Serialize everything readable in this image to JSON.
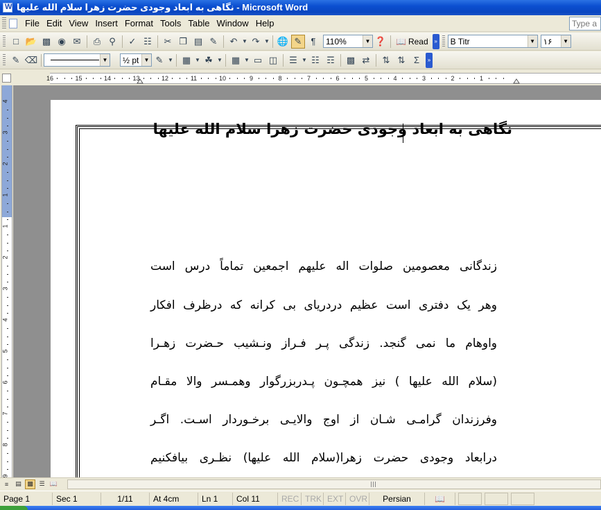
{
  "window": {
    "title": "نگاهی به ابعاد وجودی حضرت زهرا سلام الله علیها - Microsoft Word"
  },
  "menu": {
    "items": [
      {
        "label": "File"
      },
      {
        "label": "Edit"
      },
      {
        "label": "View"
      },
      {
        "label": "Insert"
      },
      {
        "label": "Format"
      },
      {
        "label": "Tools"
      },
      {
        "label": "Table"
      },
      {
        "label": "Window"
      },
      {
        "label": "Help"
      }
    ],
    "help_placeholder": "Type a"
  },
  "toolbar_standard": {
    "zoom": "110%",
    "read_label": "Read",
    "font_name": "B Titr",
    "font_size": "۱۶"
  },
  "toolbar_formatting": {
    "line_weight": "½ pt"
  },
  "ruler": {
    "labels": [
      "16",
      "15",
      "14",
      "13",
      "12",
      "11",
      "10",
      "9",
      "8",
      "7",
      "6",
      "5",
      "4",
      "3",
      "2",
      "1"
    ],
    "vertical_labels": [
      "4",
      "3",
      "2",
      "1",
      "1",
      "2",
      "3",
      "4",
      "5",
      "6",
      "7",
      "8",
      "9"
    ]
  },
  "document": {
    "title": "نگاهی به ابعاد وجودی حضرت زهرا سلام الله علیها",
    "lines": [
      "زندگانی معصومین صلوات اله علیهم اجمعین تماماً درس است",
      "وهر یک دفتری است عظیم دردریای بی کرانه که درظرف افکار",
      "واوهام ما نمی گنجد. زندگی پـر فـراز ونـشیب حـضرت زهـرا",
      "(سلام الله علیها ) نیز همچـون پـدربزرگوار وهمـسر والا مقـام",
      "وفرزندان گرامـی شـان از اوج والایـی برخـوردار اسـت. اگـر",
      "درابعاد وجودی حضرت زهرا(سلام الله علیها) نظـری بیافکنیم"
    ]
  },
  "statusbar": {
    "page": "Page 1",
    "section": "Sec 1",
    "page_of": "1/11",
    "at": "At 4cm",
    "ln": "Ln 1",
    "col": "Col 11",
    "rec": "REC",
    "trk": "TRK",
    "ext": "EXT",
    "ovr": "OVR",
    "language": "Persian"
  }
}
